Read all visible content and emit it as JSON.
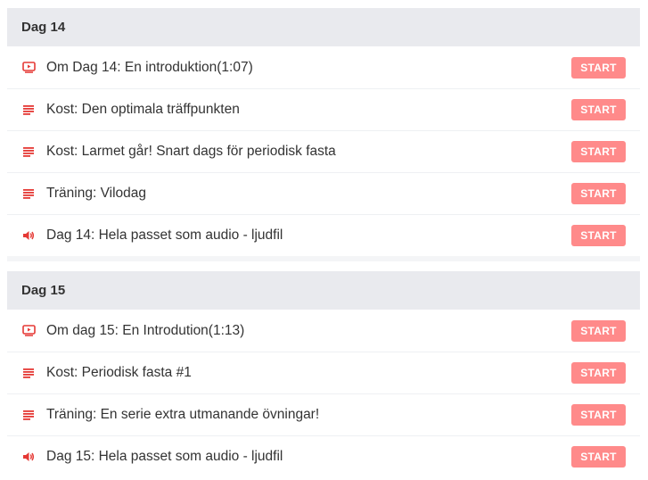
{
  "colors": {
    "accent": "#e53935",
    "start_bg": "#ff8a8a",
    "header_bg": "#e9eaee"
  },
  "sections": [
    {
      "title": "Dag 14",
      "items": [
        {
          "icon": "video-icon",
          "title": "Om Dag 14: En introduktion(1:07)",
          "button": "START"
        },
        {
          "icon": "text-lines-icon",
          "title": "Kost: Den optimala träffpunkten",
          "button": "START"
        },
        {
          "icon": "text-lines-icon",
          "title": "Kost: Larmet går! Snart dags för periodisk fasta",
          "button": "START"
        },
        {
          "icon": "text-lines-icon",
          "title": "Träning: Vilodag",
          "button": "START"
        },
        {
          "icon": "audio-icon",
          "title": "Dag 14: Hela passet som audio - ljudfil",
          "button": "START"
        }
      ]
    },
    {
      "title": "Dag 15",
      "items": [
        {
          "icon": "video-icon",
          "title": "Om dag 15: En Introdution(1:13)",
          "button": "START"
        },
        {
          "icon": "text-lines-icon",
          "title": "Kost: Periodisk fasta #1",
          "button": "START"
        },
        {
          "icon": "text-lines-icon",
          "title": "Träning: En serie extra utmanande övningar!",
          "button": "START"
        },
        {
          "icon": "audio-icon",
          "title": "Dag 15: Hela passet som audio - ljudfil",
          "button": "START"
        }
      ]
    }
  ]
}
